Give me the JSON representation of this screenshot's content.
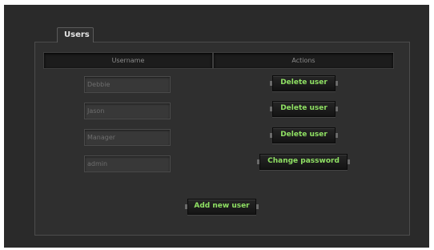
{
  "tabs": {
    "users_label": "Users"
  },
  "table": {
    "headers": {
      "username": "Username",
      "actions": "Actions"
    },
    "rows": [
      {
        "username": "Debbie",
        "action_label": "Delete user"
      },
      {
        "username": "Jason",
        "action_label": "Delete user"
      },
      {
        "username": "Manager",
        "action_label": "Delete user"
      },
      {
        "username": "admin",
        "action_label": "Change password"
      }
    ]
  },
  "footer": {
    "add_label": "Add new user"
  },
  "colors": {
    "background": "#2a2a2a",
    "panel": "#2f2f2f",
    "button_text": "#8fe063"
  }
}
